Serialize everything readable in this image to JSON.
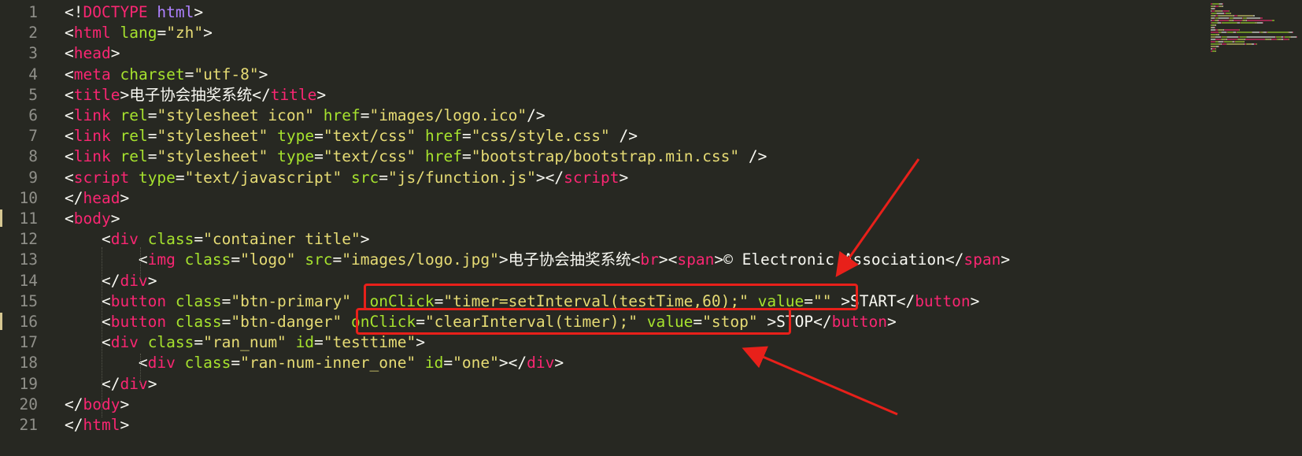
{
  "editor": {
    "language": "html",
    "line_numbers": [
      "1",
      "2",
      "3",
      "4",
      "5",
      "6",
      "7",
      "8",
      "9",
      "10",
      "11",
      "12",
      "13",
      "14",
      "15",
      "16",
      "17",
      "18",
      "19",
      "20",
      "21"
    ],
    "lines": [
      [
        [
          "punct",
          "<!"
        ],
        [
          "doctype",
          "DOCTYPE"
        ],
        [
          "punct",
          " "
        ],
        [
          "kw",
          "html"
        ],
        [
          "punct",
          ">"
        ]
      ],
      [
        [
          "punct",
          "<"
        ],
        [
          "tag",
          "html"
        ],
        [
          "punct",
          " "
        ],
        [
          "attr",
          "lang"
        ],
        [
          "punct",
          "="
        ],
        [
          "str",
          "\"zh\""
        ],
        [
          "punct",
          ">"
        ]
      ],
      [
        [
          "punct",
          "<"
        ],
        [
          "tag",
          "head"
        ],
        [
          "punct",
          ">"
        ]
      ],
      [
        [
          "punct",
          "<"
        ],
        [
          "tag",
          "meta"
        ],
        [
          "punct",
          " "
        ],
        [
          "attr",
          "charset"
        ],
        [
          "punct",
          "="
        ],
        [
          "str",
          "\"utf-8\""
        ],
        [
          "punct",
          ">"
        ]
      ],
      [
        [
          "punct",
          "<"
        ],
        [
          "tag",
          "title"
        ],
        [
          "punct",
          ">"
        ],
        [
          "text",
          "电子协会抽奖系统"
        ],
        [
          "punct",
          "</"
        ],
        [
          "tag",
          "title"
        ],
        [
          "punct",
          ">"
        ]
      ],
      [
        [
          "punct",
          "<"
        ],
        [
          "tag",
          "link"
        ],
        [
          "punct",
          " "
        ],
        [
          "attr",
          "rel"
        ],
        [
          "punct",
          "="
        ],
        [
          "str",
          "\"stylesheet icon\""
        ],
        [
          "punct",
          " "
        ],
        [
          "attr",
          "href"
        ],
        [
          "punct",
          "="
        ],
        [
          "str",
          "\"images/logo.ico\""
        ],
        [
          "punct",
          "/>"
        ]
      ],
      [
        [
          "punct",
          "<"
        ],
        [
          "tag",
          "link"
        ],
        [
          "punct",
          " "
        ],
        [
          "attr",
          "rel"
        ],
        [
          "punct",
          "="
        ],
        [
          "str",
          "\"stylesheet\""
        ],
        [
          "punct",
          " "
        ],
        [
          "attr",
          "type"
        ],
        [
          "punct",
          "="
        ],
        [
          "str",
          "\"text/css\""
        ],
        [
          "punct",
          " "
        ],
        [
          "attr",
          "href"
        ],
        [
          "punct",
          "="
        ],
        [
          "str",
          "\"css/style.css\""
        ],
        [
          "punct",
          " />"
        ]
      ],
      [
        [
          "punct",
          "<"
        ],
        [
          "tag",
          "link"
        ],
        [
          "punct",
          " "
        ],
        [
          "attr",
          "rel"
        ],
        [
          "punct",
          "="
        ],
        [
          "str",
          "\"stylesheet\""
        ],
        [
          "punct",
          " "
        ],
        [
          "attr",
          "type"
        ],
        [
          "punct",
          "="
        ],
        [
          "str",
          "\"text/css\""
        ],
        [
          "punct",
          " "
        ],
        [
          "attr",
          "href"
        ],
        [
          "punct",
          "="
        ],
        [
          "str",
          "\"bootstrap/bootstrap.min.css\""
        ],
        [
          "punct",
          " />"
        ]
      ],
      [
        [
          "punct",
          "<"
        ],
        [
          "tag",
          "script"
        ],
        [
          "punct",
          " "
        ],
        [
          "attr",
          "type"
        ],
        [
          "punct",
          "="
        ],
        [
          "str",
          "\"text/javascript\""
        ],
        [
          "punct",
          " "
        ],
        [
          "attr",
          "src"
        ],
        [
          "punct",
          "="
        ],
        [
          "str",
          "\"js/function.js\""
        ],
        [
          "punct",
          "></"
        ],
        [
          "tag",
          "script"
        ],
        [
          "punct",
          ">"
        ]
      ],
      [
        [
          "punct",
          "</"
        ],
        [
          "tag",
          "head"
        ],
        [
          "punct",
          ">"
        ]
      ],
      [
        [
          "punct",
          "<"
        ],
        [
          "tag",
          "body"
        ],
        [
          "punct",
          ">"
        ]
      ],
      [
        [
          "punct",
          "    <"
        ],
        [
          "tag",
          "div"
        ],
        [
          "punct",
          " "
        ],
        [
          "attr",
          "class"
        ],
        [
          "punct",
          "="
        ],
        [
          "str",
          "\"container title\""
        ],
        [
          "punct",
          ">"
        ]
      ],
      [
        [
          "punct",
          "        <"
        ],
        [
          "tag",
          "img"
        ],
        [
          "punct",
          " "
        ],
        [
          "attr",
          "class"
        ],
        [
          "punct",
          "="
        ],
        [
          "str",
          "\"logo\""
        ],
        [
          "punct",
          " "
        ],
        [
          "attr",
          "src"
        ],
        [
          "punct",
          "="
        ],
        [
          "str",
          "\"images/logo.jpg\""
        ],
        [
          "punct",
          ">"
        ],
        [
          "text",
          "电子协会抽奖系统"
        ],
        [
          "punct",
          "<"
        ],
        [
          "tag",
          "br"
        ],
        [
          "punct",
          "><"
        ],
        [
          "tag",
          "span"
        ],
        [
          "punct",
          ">"
        ],
        [
          "text",
          "© Electronic Association"
        ],
        [
          "punct",
          "</"
        ],
        [
          "tag",
          "span"
        ],
        [
          "punct",
          ">"
        ]
      ],
      [
        [
          "punct",
          "    </"
        ],
        [
          "tag",
          "div"
        ],
        [
          "punct",
          ">"
        ]
      ],
      [
        [
          "punct",
          "    <"
        ],
        [
          "tag",
          "button"
        ],
        [
          "punct",
          " "
        ],
        [
          "attr",
          "class"
        ],
        [
          "punct",
          "="
        ],
        [
          "str",
          "\"btn-primary\""
        ],
        [
          "punct",
          "  "
        ],
        [
          "attr",
          "onClick"
        ],
        [
          "punct",
          "="
        ],
        [
          "str",
          "\"timer=setInterval(testTime,60);\""
        ],
        [
          "punct",
          " "
        ],
        [
          "attr",
          "value"
        ],
        [
          "punct",
          "="
        ],
        [
          "str",
          "\"\""
        ],
        [
          "punct",
          " >"
        ],
        [
          "text",
          "START"
        ],
        [
          "punct",
          "</"
        ],
        [
          "tag",
          "button"
        ],
        [
          "punct",
          ">"
        ]
      ],
      [
        [
          "punct",
          "    <"
        ],
        [
          "tag",
          "button"
        ],
        [
          "punct",
          " "
        ],
        [
          "attr",
          "class"
        ],
        [
          "punct",
          "="
        ],
        [
          "str",
          "\"btn-danger\""
        ],
        [
          "punct",
          " "
        ],
        [
          "attr",
          "onClick"
        ],
        [
          "punct",
          "="
        ],
        [
          "str",
          "\"clearInterval(timer);\""
        ],
        [
          "punct",
          " "
        ],
        [
          "attr",
          "value"
        ],
        [
          "punct",
          "="
        ],
        [
          "str",
          "\"stop\""
        ],
        [
          "punct",
          " >"
        ],
        [
          "text",
          "STOP"
        ],
        [
          "punct",
          "</"
        ],
        [
          "tag",
          "button"
        ],
        [
          "punct",
          ">"
        ]
      ],
      [
        [
          "punct",
          "    <"
        ],
        [
          "tag",
          "div"
        ],
        [
          "punct",
          " "
        ],
        [
          "attr",
          "class"
        ],
        [
          "punct",
          "="
        ],
        [
          "str",
          "\"ran_num\""
        ],
        [
          "punct",
          " "
        ],
        [
          "attr",
          "id"
        ],
        [
          "punct",
          "="
        ],
        [
          "str",
          "\"testtime\""
        ],
        [
          "punct",
          ">"
        ]
      ],
      [
        [
          "punct",
          "        <"
        ],
        [
          "tag",
          "div"
        ],
        [
          "punct",
          " "
        ],
        [
          "attr",
          "class"
        ],
        [
          "punct",
          "="
        ],
        [
          "str",
          "\"ran-num-inner_one\""
        ],
        [
          "punct",
          " "
        ],
        [
          "attr",
          "id"
        ],
        [
          "punct",
          "="
        ],
        [
          "str",
          "\"one\""
        ],
        [
          "punct",
          "></"
        ],
        [
          "tag",
          "div"
        ],
        [
          "punct",
          ">"
        ]
      ],
      [
        [
          "punct",
          "    </"
        ],
        [
          "tag",
          "div"
        ],
        [
          "punct",
          ">"
        ]
      ],
      [
        [
          "punct",
          "</"
        ],
        [
          "tag",
          "body"
        ],
        [
          "punct",
          ">"
        ]
      ],
      [
        [
          "punct",
          "</"
        ],
        [
          "tag",
          "html"
        ],
        [
          "punct",
          ">"
        ]
      ]
    ],
    "modified_line_numbers": [
      "11",
      "16"
    ]
  },
  "colors": {
    "background": "#272822",
    "line_number": "#90908a",
    "punct": "#f8f8f2",
    "tag": "#f92672",
    "attr": "#a6e22e",
    "string": "#e6db74",
    "keyword": "#ae81ff",
    "annotation_red": "#e8201a"
  },
  "annotations": {
    "boxes": [
      "highlight-onclick-start",
      "highlight-onclick-stop"
    ],
    "arrows": [
      "arrow-to-start-value",
      "arrow-to-stop-onclick"
    ]
  }
}
